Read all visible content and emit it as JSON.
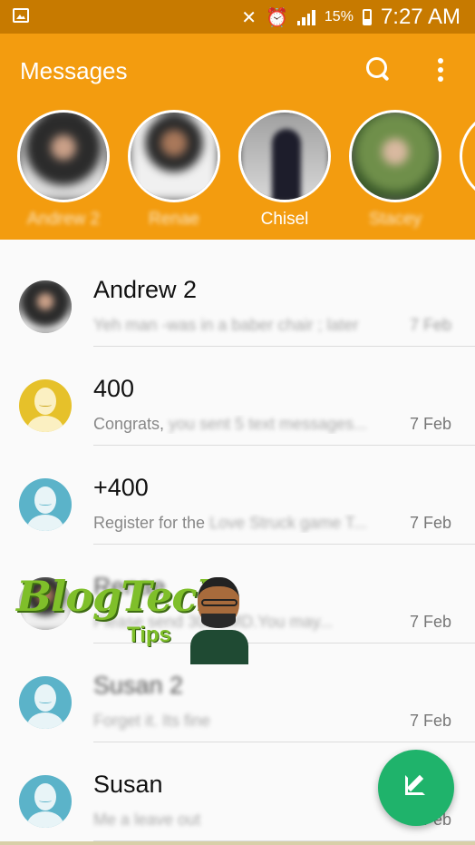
{
  "status_bar": {
    "battery_percent": "15%",
    "time": "7:27 AM",
    "icons": [
      "gallery-icon",
      "mute-vibrate-icon",
      "alarm-icon",
      "signal-icon",
      "battery-icon"
    ]
  },
  "app_bar": {
    "title": "Messages",
    "actions": [
      "search-icon",
      "more-vert-icon"
    ],
    "background": "#f39c0f"
  },
  "favorites": [
    {
      "name": "Andrew 2",
      "blurred": true
    },
    {
      "name": "Renae",
      "blurred": true
    },
    {
      "name": "Chisel",
      "blurred": false
    },
    {
      "name": "Stacey",
      "blurred": true
    }
  ],
  "conversations": [
    {
      "name": "Andrew 2",
      "snippet": "Yeh man -was in a baber chair ; later",
      "date": "7 Feb",
      "avatar": "photo",
      "blur_name": false,
      "blur_snippet": true
    },
    {
      "name": "400",
      "snippet_visible": "Congrats,",
      "snippet_blur": " you sent 5 text messages...",
      "date": "7 Feb",
      "avatar": "yellow"
    },
    {
      "name": "+400",
      "snippet_visible": "Register for the",
      "snippet_blur": " Love Struck game T...",
      "date": "7 Feb",
      "avatar": "blue"
    },
    {
      "name": "Renae",
      "snippet": "Please send 300 JMD.You may...",
      "date": "7 Feb",
      "avatar": "photo",
      "blur_name": true,
      "blur_snippet": true
    },
    {
      "name": "Susan 2",
      "snippet": "Forget it. Its fine",
      "date": "7 Feb",
      "avatar": "blue",
      "blur_name": true,
      "blur_snippet": true
    },
    {
      "name": "Susan",
      "snippet": "Me a leave out",
      "date": "7 Feb",
      "avatar": "blue",
      "blur_name": false,
      "blur_snippet": true
    }
  ],
  "watermark": {
    "brand": "BlogTech",
    "tips": "Tips"
  },
  "fab": {
    "icon": "compose-icon",
    "color": "#1fb36b"
  }
}
